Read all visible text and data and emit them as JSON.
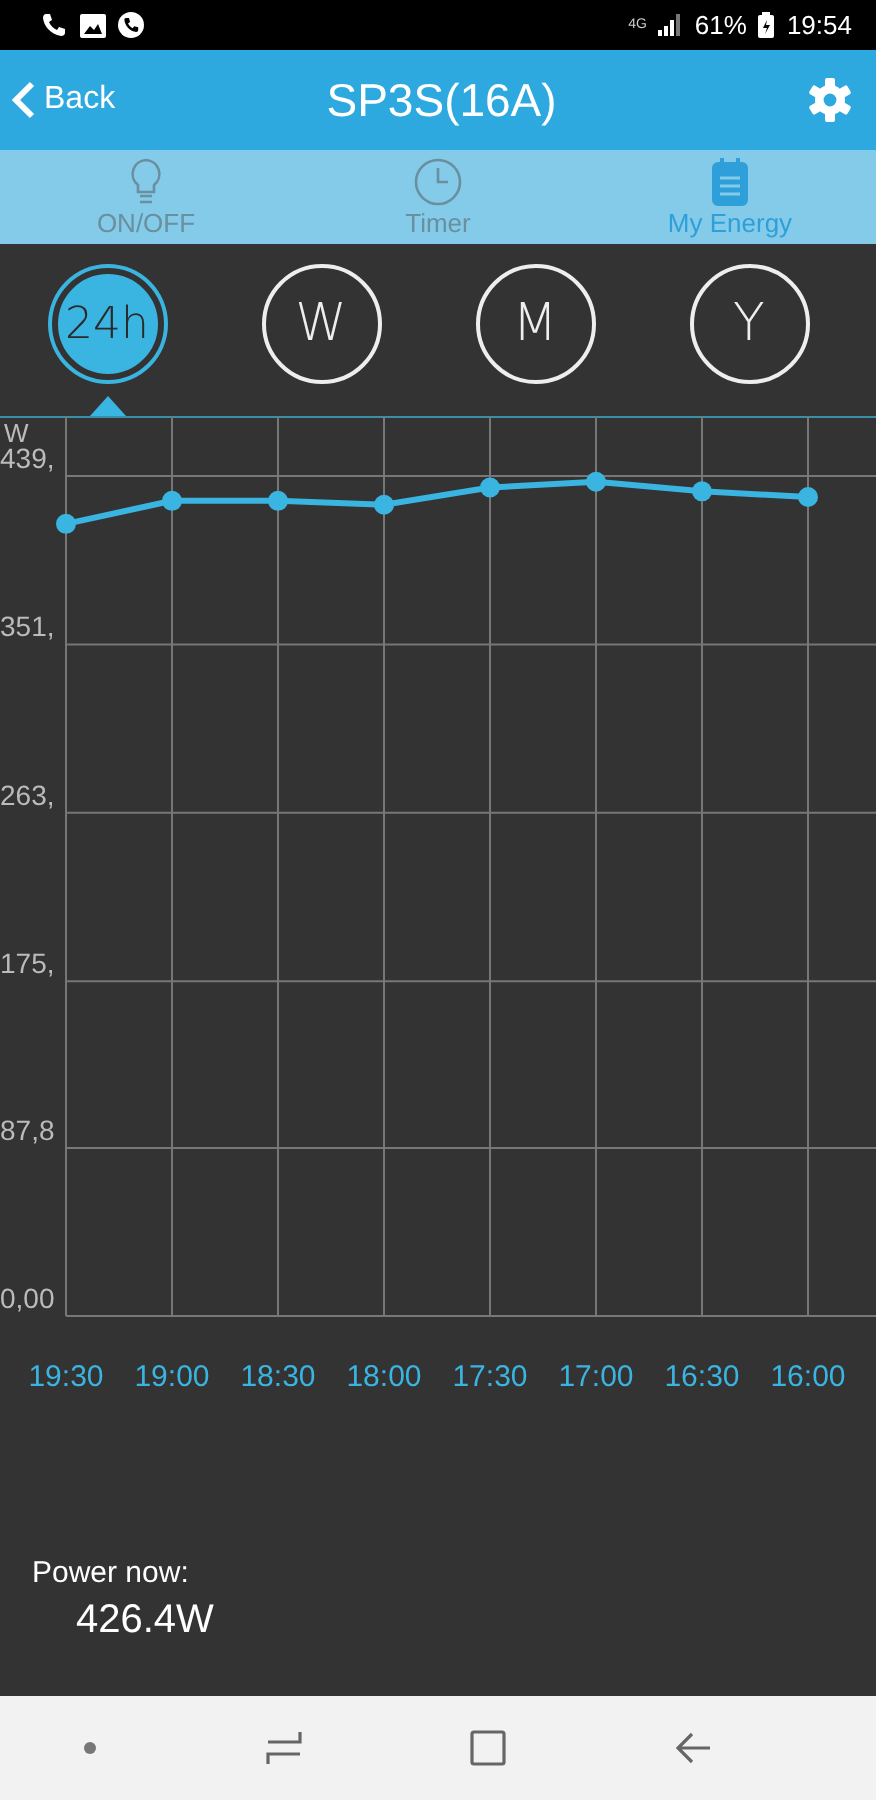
{
  "status_bar": {
    "network": "4G",
    "battery": "61%",
    "time": "19:54"
  },
  "header": {
    "back": "Back",
    "title": "SP3S(16A)"
  },
  "tabs": [
    {
      "label": "ON/OFF",
      "kind": "bulb",
      "selected": false
    },
    {
      "label": "Timer",
      "kind": "clock",
      "selected": false
    },
    {
      "label": "My Energy",
      "kind": "notepad",
      "selected": true
    }
  ],
  "periods": [
    {
      "label": "24h",
      "selected": true
    },
    {
      "label": "W",
      "selected": false
    },
    {
      "label": "M",
      "selected": false
    },
    {
      "label": "Y",
      "selected": false
    }
  ],
  "chart_data": {
    "type": "line",
    "ylabel": "W",
    "categories": [
      "19:30",
      "19:00",
      "18:30",
      "18:00",
      "17:30",
      "17:00",
      "16:30",
      "16:00"
    ],
    "series": [
      {
        "color": "#3ab4e0",
        "marker": true,
        "values": [
          414,
          426,
          426,
          424,
          433,
          436,
          431,
          428
        ]
      }
    ],
    "ylim": [
      0,
      439
    ],
    "grid": true,
    "yticks": [
      {
        "value": 0,
        "label": "0,00"
      },
      {
        "value": 87.8,
        "label": "87,8"
      },
      {
        "value": 175,
        "label": "175,"
      },
      {
        "value": 263,
        "label": "263,"
      },
      {
        "value": 351,
        "label": "351,"
      },
      {
        "value": 439,
        "label": "439,"
      }
    ]
  },
  "power_now": {
    "label": "Power now:",
    "value": "426.4W"
  }
}
